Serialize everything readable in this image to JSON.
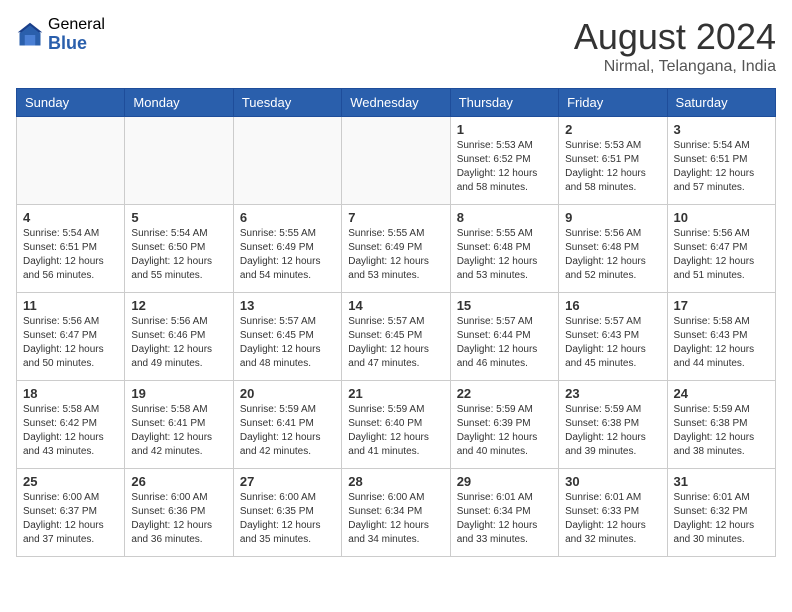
{
  "header": {
    "logo_general": "General",
    "logo_blue": "Blue",
    "month_year": "August 2024",
    "location": "Nirmal, Telangana, India"
  },
  "weekdays": [
    "Sunday",
    "Monday",
    "Tuesday",
    "Wednesday",
    "Thursday",
    "Friday",
    "Saturday"
  ],
  "weeks": [
    [
      {
        "day": "",
        "info": ""
      },
      {
        "day": "",
        "info": ""
      },
      {
        "day": "",
        "info": ""
      },
      {
        "day": "",
        "info": ""
      },
      {
        "day": "1",
        "info": "Sunrise: 5:53 AM\nSunset: 6:52 PM\nDaylight: 12 hours\nand 58 minutes."
      },
      {
        "day": "2",
        "info": "Sunrise: 5:53 AM\nSunset: 6:51 PM\nDaylight: 12 hours\nand 58 minutes."
      },
      {
        "day": "3",
        "info": "Sunrise: 5:54 AM\nSunset: 6:51 PM\nDaylight: 12 hours\nand 57 minutes."
      }
    ],
    [
      {
        "day": "4",
        "info": "Sunrise: 5:54 AM\nSunset: 6:51 PM\nDaylight: 12 hours\nand 56 minutes."
      },
      {
        "day": "5",
        "info": "Sunrise: 5:54 AM\nSunset: 6:50 PM\nDaylight: 12 hours\nand 55 minutes."
      },
      {
        "day": "6",
        "info": "Sunrise: 5:55 AM\nSunset: 6:49 PM\nDaylight: 12 hours\nand 54 minutes."
      },
      {
        "day": "7",
        "info": "Sunrise: 5:55 AM\nSunset: 6:49 PM\nDaylight: 12 hours\nand 53 minutes."
      },
      {
        "day": "8",
        "info": "Sunrise: 5:55 AM\nSunset: 6:48 PM\nDaylight: 12 hours\nand 53 minutes."
      },
      {
        "day": "9",
        "info": "Sunrise: 5:56 AM\nSunset: 6:48 PM\nDaylight: 12 hours\nand 52 minutes."
      },
      {
        "day": "10",
        "info": "Sunrise: 5:56 AM\nSunset: 6:47 PM\nDaylight: 12 hours\nand 51 minutes."
      }
    ],
    [
      {
        "day": "11",
        "info": "Sunrise: 5:56 AM\nSunset: 6:47 PM\nDaylight: 12 hours\nand 50 minutes."
      },
      {
        "day": "12",
        "info": "Sunrise: 5:56 AM\nSunset: 6:46 PM\nDaylight: 12 hours\nand 49 minutes."
      },
      {
        "day": "13",
        "info": "Sunrise: 5:57 AM\nSunset: 6:45 PM\nDaylight: 12 hours\nand 48 minutes."
      },
      {
        "day": "14",
        "info": "Sunrise: 5:57 AM\nSunset: 6:45 PM\nDaylight: 12 hours\nand 47 minutes."
      },
      {
        "day": "15",
        "info": "Sunrise: 5:57 AM\nSunset: 6:44 PM\nDaylight: 12 hours\nand 46 minutes."
      },
      {
        "day": "16",
        "info": "Sunrise: 5:57 AM\nSunset: 6:43 PM\nDaylight: 12 hours\nand 45 minutes."
      },
      {
        "day": "17",
        "info": "Sunrise: 5:58 AM\nSunset: 6:43 PM\nDaylight: 12 hours\nand 44 minutes."
      }
    ],
    [
      {
        "day": "18",
        "info": "Sunrise: 5:58 AM\nSunset: 6:42 PM\nDaylight: 12 hours\nand 43 minutes."
      },
      {
        "day": "19",
        "info": "Sunrise: 5:58 AM\nSunset: 6:41 PM\nDaylight: 12 hours\nand 42 minutes."
      },
      {
        "day": "20",
        "info": "Sunrise: 5:59 AM\nSunset: 6:41 PM\nDaylight: 12 hours\nand 42 minutes."
      },
      {
        "day": "21",
        "info": "Sunrise: 5:59 AM\nSunset: 6:40 PM\nDaylight: 12 hours\nand 41 minutes."
      },
      {
        "day": "22",
        "info": "Sunrise: 5:59 AM\nSunset: 6:39 PM\nDaylight: 12 hours\nand 40 minutes."
      },
      {
        "day": "23",
        "info": "Sunrise: 5:59 AM\nSunset: 6:38 PM\nDaylight: 12 hours\nand 39 minutes."
      },
      {
        "day": "24",
        "info": "Sunrise: 5:59 AM\nSunset: 6:38 PM\nDaylight: 12 hours\nand 38 minutes."
      }
    ],
    [
      {
        "day": "25",
        "info": "Sunrise: 6:00 AM\nSunset: 6:37 PM\nDaylight: 12 hours\nand 37 minutes."
      },
      {
        "day": "26",
        "info": "Sunrise: 6:00 AM\nSunset: 6:36 PM\nDaylight: 12 hours\nand 36 minutes."
      },
      {
        "day": "27",
        "info": "Sunrise: 6:00 AM\nSunset: 6:35 PM\nDaylight: 12 hours\nand 35 minutes."
      },
      {
        "day": "28",
        "info": "Sunrise: 6:00 AM\nSunset: 6:34 PM\nDaylight: 12 hours\nand 34 minutes."
      },
      {
        "day": "29",
        "info": "Sunrise: 6:01 AM\nSunset: 6:34 PM\nDaylight: 12 hours\nand 33 minutes."
      },
      {
        "day": "30",
        "info": "Sunrise: 6:01 AM\nSunset: 6:33 PM\nDaylight: 12 hours\nand 32 minutes."
      },
      {
        "day": "31",
        "info": "Sunrise: 6:01 AM\nSunset: 6:32 PM\nDaylight: 12 hours\nand 30 minutes."
      }
    ]
  ]
}
